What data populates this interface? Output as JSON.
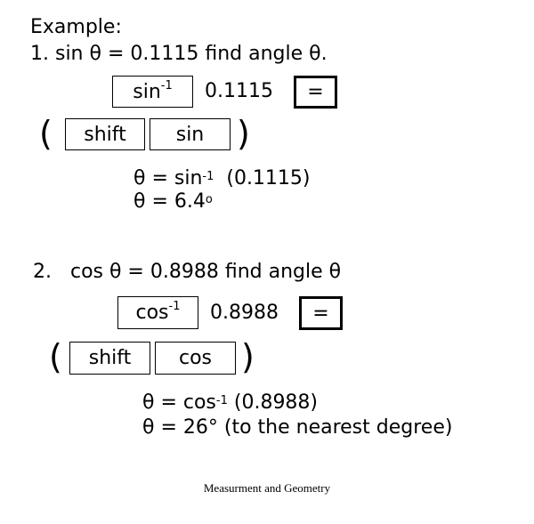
{
  "heading": "Example:",
  "example1": {
    "problem": "1. sin θ =  0.1115  find angle θ.",
    "keys": {
      "inverse_fn": "sin",
      "inverse_sup": "-1",
      "value": "0.1115",
      "equals": "=",
      "open_paren": "(",
      "shift": "shift",
      "fn": "sin",
      "close_paren": ")"
    },
    "steps": {
      "line1_prefix": "θ = sin",
      "line1_sup": "-1",
      "line1_suffix": "  (0.1115)",
      "line2_prefix": "θ = 6.4",
      "line2_sup": "o"
    }
  },
  "example2": {
    "problem": "2.   cos θ = 0.8988 find angle θ",
    "keys": {
      "inverse_fn": "cos",
      "inverse_sup": "-1",
      "value": "0.8988",
      "equals": "=",
      "open_paren": "(",
      "shift": "shift",
      "fn": "cos",
      "close_paren": ")"
    },
    "steps": {
      "line1_prefix": "θ = cos",
      "line1_sup": "-1",
      "line1_suffix": " (0.8988)",
      "line2": "θ = 26° (to the nearest degree)"
    }
  },
  "footer": "Measurment and Geometry"
}
